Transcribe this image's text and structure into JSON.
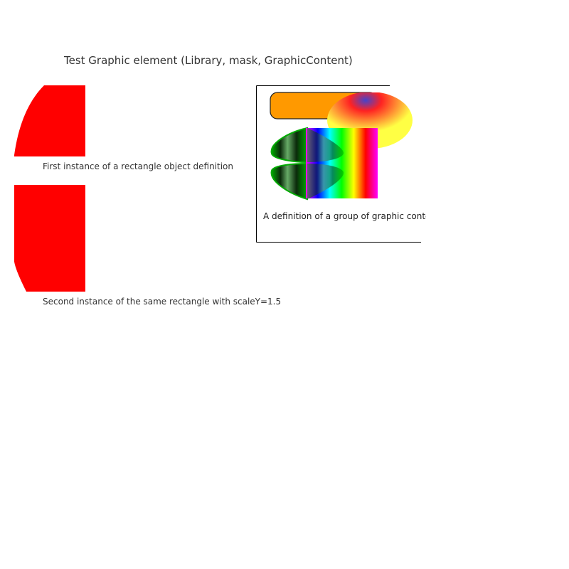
{
  "title": "Test Graphic element (Library, mask, GraphicContent)",
  "instances": [
    {
      "caption": "First instance of a rectangle object definition",
      "fill": "#ff0000",
      "scaleY": 1
    },
    {
      "caption": "Second instance of the same rectangle with scaleY=1.5",
      "fill": "#ff0000",
      "scaleY": 1.5
    }
  ],
  "group": {
    "caption": "A definition of a group of graphic content",
    "colors": {
      "pill_fill": "#ff9900",
      "pill_stroke": "#222222",
      "ellipse_outer": "#ffff44",
      "ellipse_inner": "#ff2222",
      "ellipse_core": "#4444cc",
      "leaf_stroke": "#00aa00",
      "leaf_dark": "#0a2a0a",
      "frame": "#000000"
    },
    "rainbow_stops": [
      "#ff00ff",
      "#0000ff",
      "#00ffff",
      "#00ff00",
      "#ffff00",
      "#ff0000",
      "#ff00ff"
    ]
  }
}
